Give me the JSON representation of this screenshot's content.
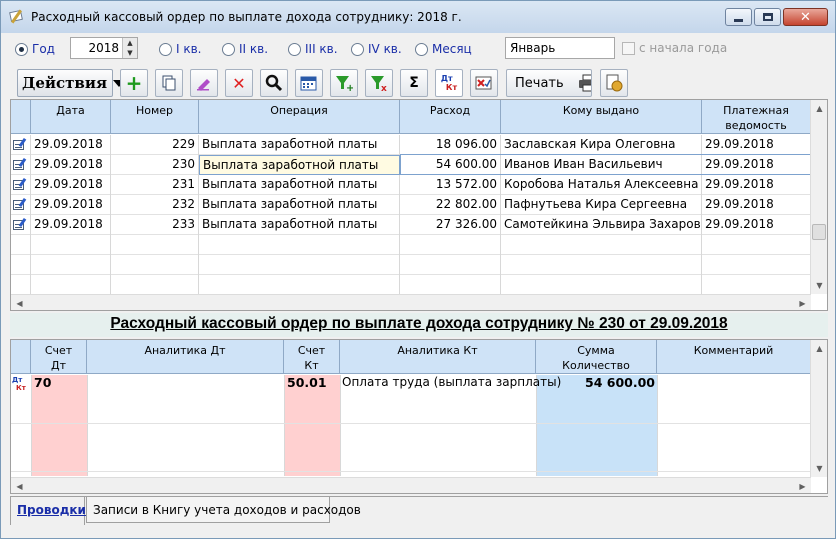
{
  "window": {
    "title": "Расходный кассовый ордер по выплате дохода сотруднику: 2018 г.",
    "close_glyph": "✕"
  },
  "period": {
    "radios": [
      {
        "label": "Год",
        "checked": true
      },
      {
        "label": "I кв.",
        "checked": false
      },
      {
        "label": "II кв.",
        "checked": false
      },
      {
        "label": "III кв.",
        "checked": false
      },
      {
        "label": "IV кв.",
        "checked": false
      },
      {
        "label": "Месяц",
        "checked": false
      }
    ],
    "year": "2018",
    "month": "Январь",
    "from_year_start": "с начала года"
  },
  "toolbar": {
    "actions_label": "Действия",
    "print_label": "Печать",
    "sum_glyph": "Σ",
    "delete_glyph": "✕",
    "add_glyph": "+",
    "dt_label": "Дт",
    "kt_label": "Кт",
    "icons": [
      "add-icon",
      "copy-icon",
      "edit-icon",
      "delete-icon",
      "search-icon",
      "calendar-icon",
      "filter-add-icon",
      "filter-remove-icon",
      "sum-icon",
      "dt-kt-icon",
      "report-icon",
      "print-icon",
      "settings-icon"
    ]
  },
  "grid1": {
    "columns": [
      "Дата",
      "Номер",
      "Операция",
      "Расход",
      "Кому выдано",
      "Платежная ведомость"
    ],
    "rows": [
      {
        "date": "29.09.2018",
        "num": "229",
        "op": "Выплата заработной платы",
        "amount": "18 096.00",
        "to": "Заславская Кира Олеговна",
        "stmt": "29.09.2018"
      },
      {
        "date": "29.09.2018",
        "num": "230",
        "op": "Выплата заработной платы",
        "amount": "54 600.00",
        "to": "Иванов Иван Васильевич",
        "stmt": "29.09.2018"
      },
      {
        "date": "29.09.2018",
        "num": "231",
        "op": "Выплата заработной платы",
        "amount": "13 572.00",
        "to": "Коробова Наталья Алексеевна",
        "stmt": "29.09.2018"
      },
      {
        "date": "29.09.2018",
        "num": "232",
        "op": "Выплата заработной платы",
        "amount": "22 802.00",
        "to": "Пафнутьева Кира Сергеевна",
        "stmt": "29.09.2018"
      },
      {
        "date": "29.09.2018",
        "num": "233",
        "op": "Выплата заработной платы",
        "amount": "27 326.00",
        "to": "Самотейкина Эльвира Захаровна",
        "stmt": "29.09.2018"
      }
    ]
  },
  "doc_title": "Расходный кассовый ордер по выплате дохода сотруднику № 230 от 29.09.2018",
  "grid2": {
    "columns": [
      "Счет Дт",
      "Аналитика Дт",
      "Счет Кт",
      "Аналитика Кт",
      "Сумма Количество",
      "Комментарий"
    ],
    "entry": {
      "dt": "70",
      "an_dt": "",
      "kt": "50.01",
      "an_kt": "Оплата труда (выплата зарплаты)",
      "sum": "54 600.00",
      "comment": ""
    },
    "dt_label": "Дт",
    "kt_label": "Кт"
  },
  "tabs": [
    "Проводки",
    "Записи в Книгу учета доходов и расходов"
  ],
  "colors": {
    "header": "#cfe3f7",
    "dt_col": "#ffd0d0",
    "sum_col": "#c8e2f8",
    "accent": "#1a2ea8"
  }
}
